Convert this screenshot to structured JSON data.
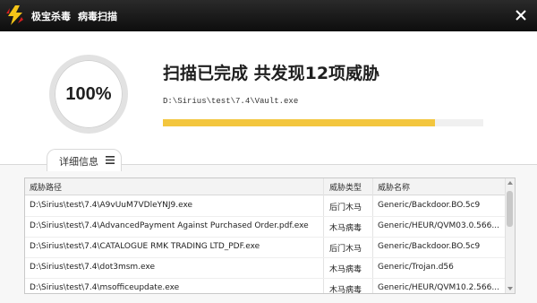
{
  "titlebar": {
    "app_name": "极宝杀毒",
    "subtitle": "病毒扫描",
    "logo_icon": "lightning-logo-icon",
    "close_icon": "close-icon"
  },
  "header": {
    "progress_percent_text": "100%",
    "headline": "扫描已完成 共发现12项威胁",
    "current_path": "D:\\Sirius\\test\\7.4\\Vault.exe",
    "progress": 0.85,
    "accent_color": "#f3c63e"
  },
  "details_tab": {
    "label": "详细信息",
    "menu_icon": "hamburger-menu-icon"
  },
  "table": {
    "columns": [
      "威胁路径",
      "威胁类型",
      "威胁名称"
    ],
    "rows": [
      [
        "D:\\Sirius\\test\\7.4\\A9vUuM7VDleYNJ9.exe",
        "后门木马",
        "Generic/Backdoor.BO.5c9"
      ],
      [
        "D:\\Sirius\\test\\7.4\\AdvancedPayment Against Purchased Order.pdf.exe",
        "木马病毒",
        "Generic/HEUR/QVM03.0.566..."
      ],
      [
        "D:\\Sirius\\test\\7.4\\CATALOGUE RMK TRADING LTD_PDF.exe",
        "后门木马",
        "Generic/Backdoor.BO.5c9"
      ],
      [
        "D:\\Sirius\\test\\7.4\\dot3msm.exe",
        "木马病毒",
        "Generic/Trojan.d56"
      ],
      [
        "D:\\Sirius\\test\\7.4\\msofficeupdate.exe",
        "木马病毒",
        "Generic/HEUR/QVM10.2.566..."
      ]
    ]
  }
}
